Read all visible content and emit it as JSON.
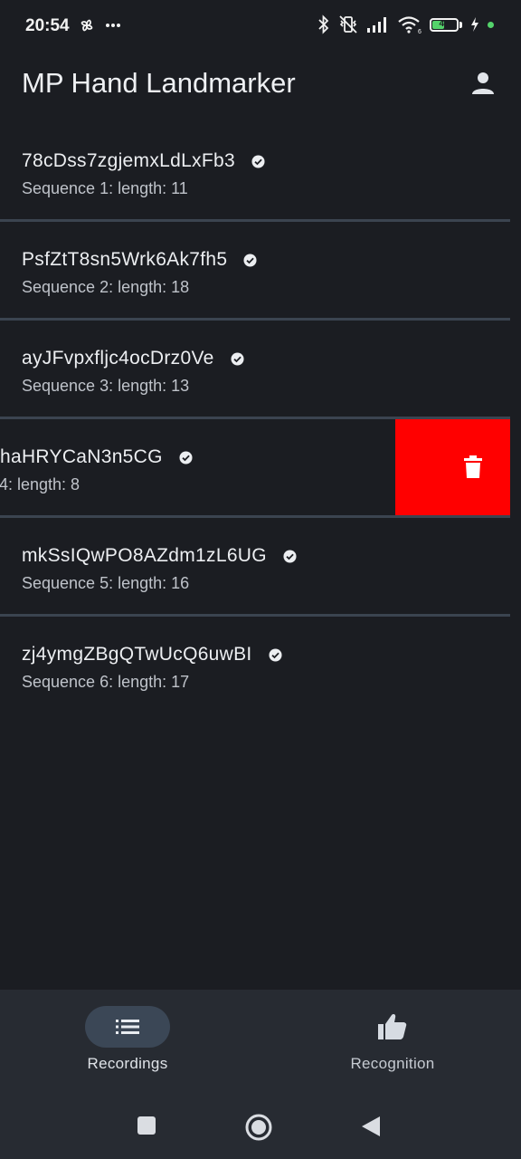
{
  "status_bar": {
    "time": "20:54",
    "battery_level": "47",
    "icons": [
      "pinwheel-icon",
      "more-dots-icon",
      "bluetooth-icon",
      "vibrate-off-icon",
      "signal-icon",
      "wifi-icon",
      "battery-icon",
      "charging-icon"
    ]
  },
  "app_bar": {
    "title": "MP Hand Landmarker",
    "account_icon": "person-icon"
  },
  "recordings": [
    {
      "id": "78cDss7zgjemxLdLxFb3",
      "subtitle": "Sequence 1: length: 11"
    },
    {
      "id": "PsfZtT8sn5Wrk6Ak7fh5",
      "subtitle": "Sequence 2: length: 18"
    },
    {
      "id": "ayJFvpxfljc4ocDrz0Ve",
      "subtitle": "Sequence 3: length: 13"
    },
    {
      "id": "haHRYCaN3n5CG",
      "subtitle": "4: length: 8",
      "swiped": true
    },
    {
      "id": "mkSsIQwPO8AZdm1zL6UG",
      "subtitle": "Sequence 5: length: 16"
    },
    {
      "id": "zj4ymgZBgQTwUcQ6uwBI",
      "subtitle": "Sequence 6: length: 17"
    }
  ],
  "delete_action": {
    "icon": "trash-icon",
    "color": "#ff0000"
  },
  "bottom_nav": {
    "items": [
      {
        "label": "Recordings",
        "icon": "list-icon",
        "selected": true
      },
      {
        "label": "Recognition",
        "icon": "thumbs-up-icon",
        "selected": false
      }
    ]
  },
  "system_nav": {
    "icons": [
      "recents-icon",
      "home-icon",
      "back-icon"
    ]
  },
  "colors": {
    "background": "#1b1d22",
    "divider": "#3b4450",
    "nav_background": "#272b32",
    "selected_pill": "#3b4756",
    "delete": "#ff0000",
    "battery": "#54d36b"
  }
}
